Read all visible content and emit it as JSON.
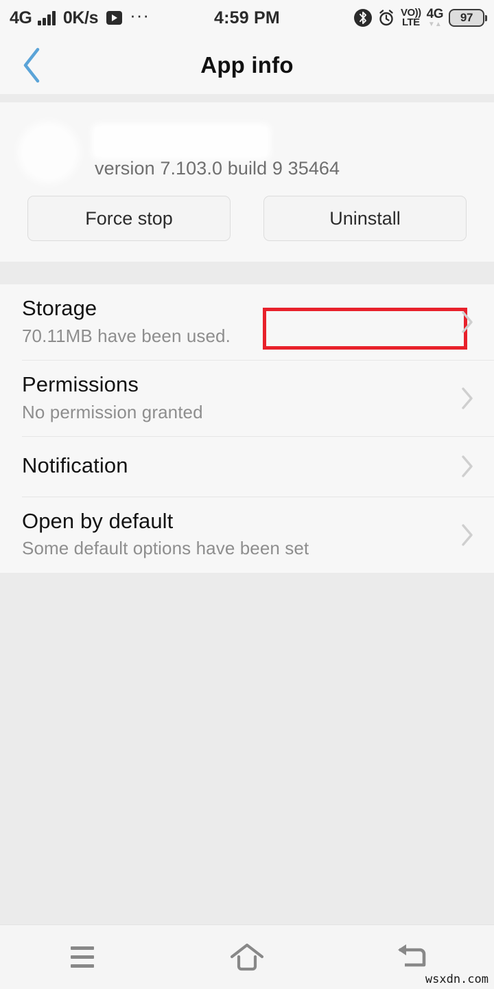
{
  "status_bar": {
    "network_type": "4G",
    "signal_icon": "signal-bars-icon",
    "data_speed": "0K/s",
    "media_icon": "play-icon",
    "more_icon": "ellipsis-icon",
    "clock": "4:59 PM",
    "bluetooth_icon": "bluetooth-icon",
    "alarm_icon": "alarm-clock-icon",
    "volte_line1": "VO))",
    "volte_line2": "LTE",
    "mobile_data": "4G",
    "data_arrows": "▼▲",
    "battery_level": "97"
  },
  "app_bar": {
    "back_icon": "back-chevron-icon",
    "title": "App info"
  },
  "app_header": {
    "icon_name": "app-icon-redacted",
    "app_name": "",
    "version": "version 7.103.0 build 9 35464",
    "buttons": [
      {
        "label": "Force stop",
        "name": "force-stop-button"
      },
      {
        "label": "Uninstall",
        "name": "uninstall-button"
      }
    ],
    "highlight_target": "uninstall-button",
    "highlight_color": "#e8212b"
  },
  "list": [
    {
      "title": "Storage",
      "subtitle": "70.11MB have been used.",
      "chevron": "chevron-right-icon"
    },
    {
      "title": "Permissions",
      "subtitle": "No permission granted",
      "chevron": "chevron-right-icon"
    },
    {
      "title": "Notification",
      "subtitle": "",
      "chevron": "chevron-right-icon"
    },
    {
      "title": "Open by default",
      "subtitle": "Some default options have been set",
      "chevron": "chevron-right-icon"
    }
  ],
  "nav_bar": {
    "menu_icon": "menu-icon",
    "home_icon": "home-icon",
    "back_icon": "back-arrow-icon"
  },
  "watermark": "wsxdn.com",
  "colors": {
    "accent_blue": "#5ba4d8",
    "page_bg": "#f7f7f7",
    "band_bg": "#ebebeb",
    "highlight_red": "#e8212b"
  }
}
